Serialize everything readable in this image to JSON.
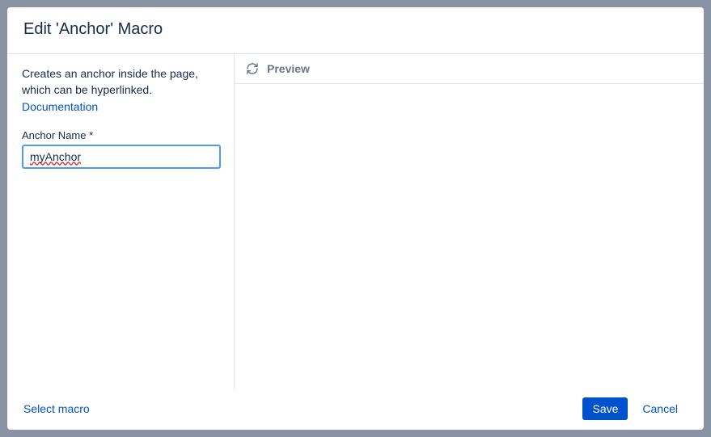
{
  "dialog": {
    "title": "Edit 'Anchor' Macro"
  },
  "sidebar": {
    "description": "Creates an anchor inside the page, which can be hyperlinked.",
    "documentation_link": "Documentation",
    "field_label": "Anchor Name *",
    "anchor_name_value": "myAnchor"
  },
  "preview": {
    "label": "Preview"
  },
  "footer": {
    "select_macro_label": "Select macro",
    "save_label": "Save",
    "cancel_label": "Cancel"
  }
}
